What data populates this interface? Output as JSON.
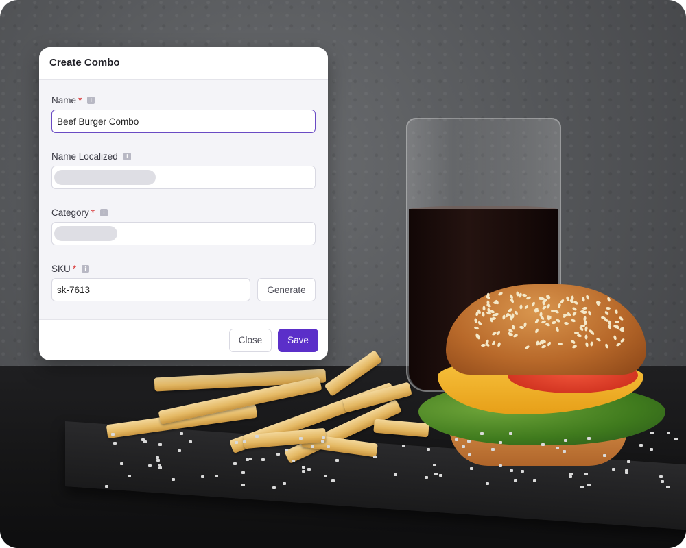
{
  "dialog": {
    "title": "Create Combo",
    "fields": {
      "name": {
        "label": "Name",
        "required_mark": "*",
        "value": "Beef Burger Combo"
      },
      "name_localized": {
        "label": "Name Localized"
      },
      "category": {
        "label": "Category",
        "required_mark": "*"
      },
      "sku": {
        "label": "SKU",
        "required_mark": "*",
        "value": "sk-7613"
      }
    },
    "buttons": {
      "generate": "Generate",
      "close": "Close",
      "save": "Save"
    },
    "info_icon_glyph": "i"
  },
  "colors": {
    "accent": "#5b2fc9",
    "focus_border": "#6a4bc4",
    "required": "#d93a3a"
  },
  "background": {
    "description_icons": [
      "glass-of-cola",
      "cheeseburger",
      "french-fries"
    ]
  }
}
